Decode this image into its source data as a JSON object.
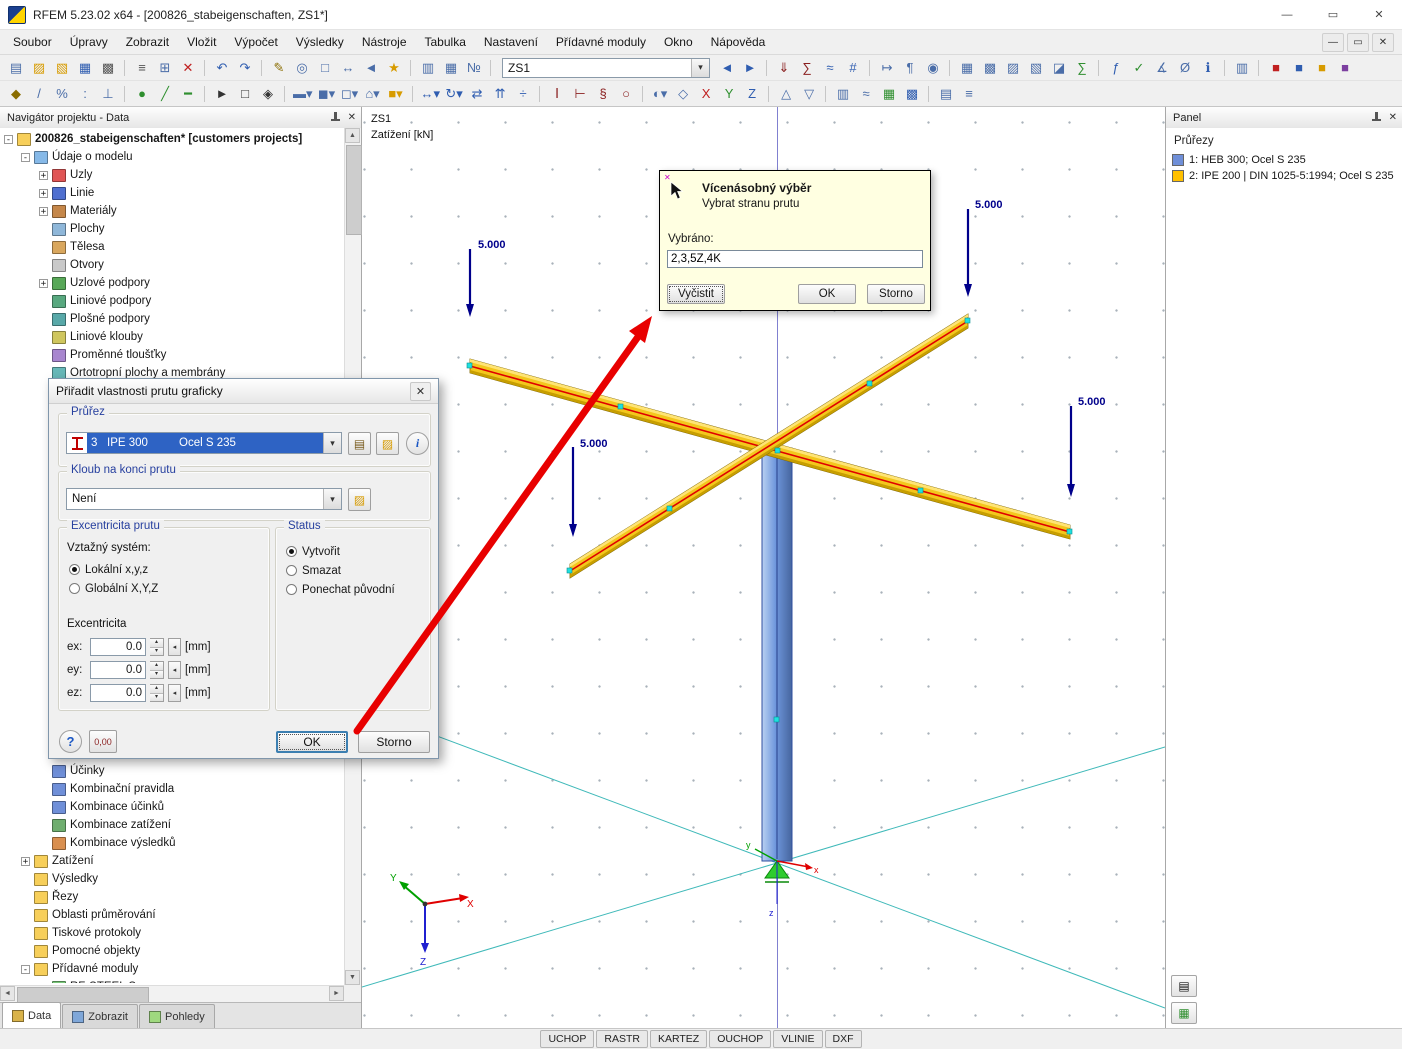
{
  "window": {
    "title": "RFEM 5.23.02 x64 - [200826_stabeigenschaften, ZS1*]",
    "controls": {
      "minimize": "—",
      "maximize": "▭",
      "close": "✕"
    }
  },
  "menubar": {
    "items": [
      "Soubor",
      "Úpravy",
      "Zobrazit",
      "Vložit",
      "Výpočet",
      "Výsledky",
      "Nástroje",
      "Tabulka",
      "Nastavení",
      "Přídavné moduly",
      "Okno",
      "Nápověda"
    ],
    "mdi": [
      "—",
      "▭",
      "✕"
    ]
  },
  "toolbar1": {
    "case_combo": "ZS1",
    "left": [
      {
        "n": "new-file",
        "g": "▤",
        "c": "#4a6da8"
      },
      {
        "n": "open-project",
        "g": "▨",
        "c": "#d79b00"
      },
      {
        "n": "open-file",
        "g": "▧",
        "c": "#d79b00"
      },
      {
        "n": "save",
        "g": "▦",
        "c": "#2f5db0"
      },
      {
        "n": "print",
        "g": "▩",
        "c": "#555555",
        "sep": "1"
      },
      {
        "n": "print-preview",
        "g": "≡",
        "c": "#555555"
      },
      {
        "n": "copy",
        "g": "⊞",
        "c": "#4a6da8"
      },
      {
        "n": "delete",
        "g": "✕",
        "c": "#c02020",
        "sep": "1"
      },
      {
        "n": "undo",
        "g": "↶",
        "c": "#2f5db0"
      },
      {
        "n": "redo",
        "g": "↷",
        "c": "#2f5db0",
        "sep": "1"
      },
      {
        "n": "edit-pen",
        "g": "✎",
        "c": "#8a6d00"
      },
      {
        "n": "zoom",
        "g": "◎",
        "c": "#4a6da8"
      },
      {
        "n": "zoom-window",
        "g": "□",
        "c": "#4a6da8"
      },
      {
        "n": "pan-view",
        "g": "↔",
        "c": "#4a6da8"
      },
      {
        "n": "previous-view",
        "g": "◄",
        "c": "#4a6da8"
      },
      {
        "n": "favorites",
        "g": "★",
        "c": "#d79b00",
        "sep": "1"
      },
      {
        "n": "show-tables",
        "g": "▥",
        "c": "#4a6da8"
      },
      {
        "n": "table-settings",
        "g": "▦",
        "c": "#4a6da8"
      },
      {
        "n": "numbering",
        "g": "№",
        "c": "#4a6da8",
        "sep": "1"
      }
    ],
    "right": [
      {
        "n": "previous-load-case",
        "g": "◄",
        "c": "#2f5db0"
      },
      {
        "n": "next-load-case",
        "g": "►",
        "c": "#2f5db0",
        "sep": "1"
      },
      {
        "n": "show-loads",
        "g": "⇓",
        "c": "#8a1f1f"
      },
      {
        "n": "show-load-values",
        "g": "∑",
        "c": "#8a1f1f"
      },
      {
        "n": "show-results",
        "g": "≈",
        "c": "#2f5db0"
      },
      {
        "n": "show-numbers",
        "g": "#",
        "c": "#2f5db0",
        "sep": "1"
      },
      {
        "n": "dimensions",
        "g": "↦",
        "c": "#4a6da8"
      },
      {
        "n": "comment",
        "g": "¶",
        "c": "#4a6da8"
      },
      {
        "n": "camera",
        "g": "◉",
        "c": "#4a6da8",
        "sep": "1"
      },
      {
        "n": "render-wireframe",
        "g": "▦",
        "c": "#4a6da8"
      },
      {
        "n": "render-solid",
        "g": "▩",
        "c": "#4a6da8"
      },
      {
        "n": "render-transparent",
        "g": "▨",
        "c": "#4a6da8"
      },
      {
        "n": "render-outline",
        "g": "▧",
        "c": "#4a6da8"
      },
      {
        "n": "renderer-settings",
        "g": "◪",
        "c": "#4a6da8"
      },
      {
        "n": "calculate",
        "g": "∑",
        "c": "#2f8f2f",
        "sep": "1"
      },
      {
        "n": "generate",
        "g": "ƒ",
        "c": "#2f5db0"
      },
      {
        "n": "check-model",
        "g": "✓",
        "c": "#2f8f2f"
      },
      {
        "n": "measure",
        "g": "∡",
        "c": "#4a6da8"
      },
      {
        "n": "section-cut",
        "g": "Ø",
        "c": "#4a6da8"
      },
      {
        "n": "info",
        "g": "ℹ",
        "c": "#2f5db0",
        "sep": "1"
      },
      {
        "n": "display-panel",
        "g": "▥",
        "c": "#4a6da8",
        "sep": "1"
      },
      {
        "n": "export-1",
        "g": "■",
        "c": "#c02020"
      },
      {
        "n": "export-2",
        "g": "■",
        "c": "#2f5db0"
      },
      {
        "n": "export-3",
        "g": "■",
        "c": "#d79b00"
      },
      {
        "n": "export-4",
        "g": "■",
        "c": "#7c3fa0"
      }
    ]
  },
  "toolbar2": {
    "items": [
      {
        "n": "snap",
        "g": "◆",
        "c": "#8a6d00"
      },
      {
        "n": "guidelines",
        "g": "/",
        "c": "#4a6da8"
      },
      {
        "n": "snap-percent",
        "g": "%",
        "c": "#4a6da8"
      },
      {
        "n": "snap-grid",
        "g": ":",
        "c": "#4a6da8"
      },
      {
        "n": "ortho",
        "g": "⊥",
        "c": "#4a6da8",
        "sep": "1"
      },
      {
        "n": "insert-node",
        "g": "●",
        "c": "#2f8f2f"
      },
      {
        "n": "insert-line",
        "g": "╱",
        "c": "#2f8f2f"
      },
      {
        "n": "insert-member",
        "g": "━",
        "c": "#2f8f2f",
        "sep": "1"
      },
      {
        "n": "select",
        "g": "►",
        "c": "#333333"
      },
      {
        "n": "select-window",
        "g": "□",
        "c": "#333333"
      },
      {
        "n": "select-special",
        "g": "◈",
        "c": "#333333",
        "sep": "1"
      },
      {
        "n": "new-surface",
        "g": "▬▾",
        "c": "#4a6da8"
      },
      {
        "n": "new-solid",
        "g": "◼▾",
        "c": "#4a6da8"
      },
      {
        "n": "new-opening",
        "g": "◻▾",
        "c": "#4a6da8"
      },
      {
        "n": "model-generator",
        "g": "⌂▾",
        "c": "#4a6da8"
      },
      {
        "n": "blocks",
        "g": "■▾",
        "c": "#d79b00",
        "sep": "1"
      },
      {
        "n": "move-copy",
        "g": "↔▾",
        "c": "#2f5db0"
      },
      {
        "n": "rotate",
        "g": "↻▾",
        "c": "#2f5db0"
      },
      {
        "n": "mirror",
        "g": "⇄",
        "c": "#2f5db0"
      },
      {
        "n": "extrude",
        "g": "⇈",
        "c": "#2f5db0"
      },
      {
        "n": "divide",
        "g": "÷",
        "c": "#2f5db0",
        "sep": "1"
      },
      {
        "n": "member-section",
        "g": "Ⅰ",
        "c": "#8a1f1f"
      },
      {
        "n": "member-hinge",
        "g": "⊢",
        "c": "#8a1f1f"
      },
      {
        "n": "member-stiffness",
        "g": "§",
        "c": "#8a1f1f"
      },
      {
        "n": "member-rotation",
        "g": "○",
        "c": "#8a1f1f",
        "sep": "1"
      },
      {
        "n": "visibility",
        "g": "◐▾",
        "c": "#4a6da8"
      },
      {
        "n": "user-views",
        "g": "◇",
        "c": "#4a6da8"
      },
      {
        "n": "view-x",
        "g": "X",
        "c": "#c02020"
      },
      {
        "n": "view-y",
        "g": "Y",
        "c": "#2f8f2f"
      },
      {
        "n": "view-z",
        "g": "Z",
        "c": "#2f5db0",
        "sep": "1"
      },
      {
        "n": "isometric-view",
        "g": "△",
        "c": "#4a6da8"
      },
      {
        "n": "perspective-view",
        "g": "▽",
        "c": "#4a6da8",
        "sep": "1"
      },
      {
        "n": "control-panel",
        "g": "▥",
        "c": "#4a6da8"
      },
      {
        "n": "result-diagrams",
        "g": "≈",
        "c": "#4a6da8"
      },
      {
        "n": "color-scale",
        "g": "▦",
        "c": "#2f8f2f"
      },
      {
        "n": "background",
        "g": "▩",
        "c": "#2f5db0",
        "sep": "1"
      },
      {
        "n": "tables",
        "g": "▤",
        "c": "#4a6da8"
      },
      {
        "n": "charts",
        "g": "≡",
        "c": "#4a6da8"
      }
    ]
  },
  "navigator": {
    "title": "Navigátor projektu - Data",
    "tree_top": [
      {
        "lvl": "0",
        "exp": "-",
        "color": "#f7cf5a",
        "label": "200826_stabeigenschaften* [customers projects]"
      },
      {
        "lvl": "1",
        "exp": "-",
        "color": "#86b9e8",
        "label": "Údaje o modelu"
      },
      {
        "lvl": "2",
        "exp": "+",
        "color": "#e05555",
        "label": "Uzly"
      },
      {
        "lvl": "2",
        "exp": "+",
        "color": "#4f6fd0",
        "label": "Linie"
      },
      {
        "lvl": "2",
        "exp": "+",
        "color": "#c5874a",
        "label": "Materiály"
      },
      {
        "lvl": "2",
        "exp": "",
        "color": "#8fb7d9",
        "label": "Plochy"
      },
      {
        "lvl": "2",
        "exp": "",
        "color": "#d9a75e",
        "label": "Tělesa"
      },
      {
        "lvl": "2",
        "exp": "",
        "color": "#c9c9c9",
        "label": "Otvory"
      },
      {
        "lvl": "2",
        "exp": "+",
        "color": "#58a858",
        "label": "Uzlové podpory"
      },
      {
        "lvl": "2",
        "exp": "",
        "color": "#58a87f",
        "label": "Liniové podpory"
      },
      {
        "lvl": "2",
        "exp": "",
        "color": "#58a8a8",
        "label": "Plošné podpory"
      },
      {
        "lvl": "2",
        "exp": "",
        "color": "#cfc65e",
        "label": "Liniové klouby"
      },
      {
        "lvl": "2",
        "exp": "",
        "color": "#a886cf",
        "label": "Proměnné tloušťky"
      },
      {
        "lvl": "2",
        "exp": "",
        "color": "#67b8b8",
        "label": "Ortotropní plochy a membrány"
      }
    ],
    "tree_bottom": [
      {
        "lvl": "2",
        "exp": "",
        "color": "#6f8fd8",
        "label": "Účinky"
      },
      {
        "lvl": "2",
        "exp": "",
        "color": "#6f8fd8",
        "label": "Kombinační pravidla"
      },
      {
        "lvl": "2",
        "exp": "",
        "color": "#6f8fd8",
        "label": "Kombinace účinků"
      },
      {
        "lvl": "2",
        "exp": "",
        "color": "#6fae6f",
        "label": "Kombinace zatížení"
      },
      {
        "lvl": "2",
        "exp": "",
        "color": "#d98f4f",
        "label": "Kombinace výsledků"
      },
      {
        "lvl": "1",
        "exp": "+",
        "color": "#f7cf5a",
        "label": "Zatížení"
      },
      {
        "lvl": "1",
        "exp": "",
        "color": "#f7cf5a",
        "label": "Výsledky"
      },
      {
        "lvl": "1",
        "exp": "",
        "color": "#f7cf5a",
        "label": "Řezy"
      },
      {
        "lvl": "1",
        "exp": "",
        "color": "#f7cf5a",
        "label": "Oblasti průměrování"
      },
      {
        "lvl": "1",
        "exp": "",
        "color": "#f7cf5a",
        "label": "Tiskové protokoly"
      },
      {
        "lvl": "1",
        "exp": "",
        "color": "#f7cf5a",
        "label": "Pomocné objekty"
      },
      {
        "lvl": "1",
        "exp": "-",
        "color": "#f7cf5a",
        "label": "Přídavné moduly"
      },
      {
        "lvl": "2",
        "exp": "",
        "color": "#79c779",
        "label": "RF-STEEL S..."
      }
    ],
    "tabs": [
      {
        "label": "Data",
        "active": "1",
        "ic": "#d9b34a"
      },
      {
        "label": "Zobrazit",
        "active": "",
        "ic": "#7fa7d9"
      },
      {
        "label": "Pohledy",
        "active": "",
        "ic": "#9fd97f"
      }
    ]
  },
  "dialog": {
    "title": "Přiřadit vlastnosti prutu graficky",
    "close": "✕",
    "groups": {
      "section": {
        "caption": "Průřez",
        "num": "3",
        "name": "IPE 300",
        "material": "Ocel S 235"
      },
      "hinge": {
        "caption": "Kloub na konci prutu",
        "value": "Není"
      },
      "ecc": {
        "caption": "Excentricita prutu",
        "ref_label": "Vztažný systém:",
        "radios": [
          {
            "label": "Lokální x,y,z",
            "checked": "yes"
          },
          {
            "label": "Globální X,Y,Z",
            "checked": ""
          }
        ],
        "ecc_label": "Excentricita",
        "rows": [
          {
            "label": "ex:",
            "value": "0.0",
            "unit": "[mm]"
          },
          {
            "label": "ey:",
            "value": "0.0",
            "unit": "[mm]"
          },
          {
            "label": "ez:",
            "value": "0.0",
            "unit": "[mm]"
          }
        ]
      },
      "status": {
        "caption": "Status",
        "radios": [
          {
            "label": "Vytvořit",
            "checked": "yes"
          },
          {
            "label": "Smazat",
            "checked": ""
          },
          {
            "label": "Ponechat původní",
            "checked": ""
          }
        ]
      }
    },
    "help": "?",
    "units": "0,00",
    "ok": "OK",
    "cancel": "Storno"
  },
  "tooltip": {
    "title": "Vícenásobný výběr",
    "subtitle": "Vybrat stranu prutu",
    "selected_label": "Vybráno:",
    "selected_value": "2,3,5Z,4K",
    "clear": "Vyčistit",
    "ok": "OK",
    "cancel": "Storno"
  },
  "viewport": {
    "case_label": "ZS1",
    "unit_label": "Zatížení [kN]",
    "loads": [
      "5.000",
      "5.000",
      "5.000",
      "5.000"
    ],
    "axis_big": {
      "x": "X",
      "y": "Y",
      "z": "Z"
    },
    "axis_origin": {
      "x": "x",
      "y": "y",
      "z": "z"
    },
    "colors": {
      "beam": "#f3c71d",
      "beam_top": "#ffe474",
      "beam_bottom": "#c79e00",
      "member_axis": "#e00000",
      "load": "#00008b",
      "node": "#1ee0e0",
      "support": "#13a913",
      "annotation_arrow": "#e80000"
    }
  },
  "panel": {
    "title": "Panel",
    "section": "Průřezy",
    "items": [
      {
        "color": "#6f8fd8",
        "label": "1: HEB 300; Ocel S 235"
      },
      {
        "color": "#ffc000",
        "label": "2: IPE 200 | DIN 1025-5:1994; Ocel S 235"
      }
    ]
  },
  "statusbar": {
    "toggles": [
      "UCHOP",
      "RASTR",
      "KARTEZ",
      "OUCHOP",
      "VLINIE",
      "DXF"
    ]
  }
}
